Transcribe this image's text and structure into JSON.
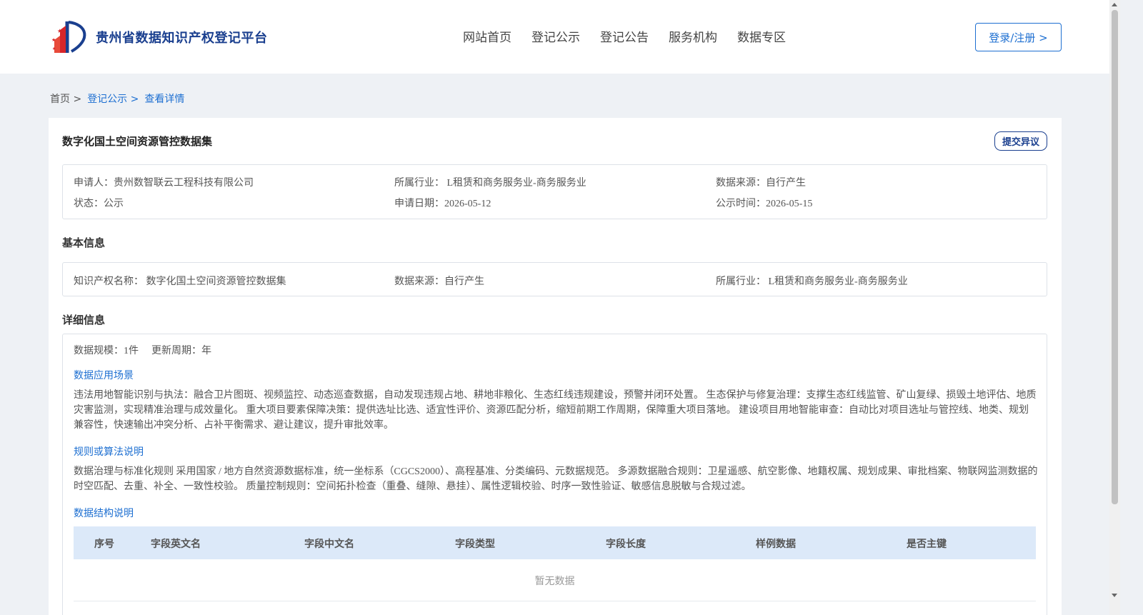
{
  "site": {
    "name": "贵州省数据知识产权登记平台"
  },
  "nav": {
    "items": [
      "网站首页",
      "登记公示",
      "登记公告",
      "服务机构",
      "数据专区"
    ]
  },
  "login": {
    "label": "登录/注册 >"
  },
  "breadcrumb": {
    "home": "首页 >",
    "level1": "登记公示 >",
    "level2": "查看详情"
  },
  "record": {
    "title": "数字化国土空间资源管控数据集",
    "objection_label": "提交异议",
    "summary": {
      "applicant": "申请人：贵州数智联云工程科技有限公司",
      "industry": "所属行业： L租赁和商务服务业-商务服务业",
      "source": "数据来源：自行产生",
      "status": "状态：公示",
      "apply_date": "申请日期：2026-05-12",
      "publish_date": "公示时间：2026-05-15"
    },
    "basic": {
      "heading": "基本信息",
      "ip_name": "知识产权名称： 数字化国土空间资源管控数据集",
      "source": "数据来源：自行产生",
      "industry": "所属行业： L租赁和商务服务业-商务服务业"
    },
    "detail": {
      "heading": "详细信息",
      "scale": "数据规模：1件",
      "cycle": "更新周期：年",
      "scenario_heading": "数据应用场景",
      "scenario_text": "违法用地智能识别与执法：融合卫片图斑、视频监控、动态巡查数据，自动发现违规占地、耕地非粮化、生态红线违规建设，预警并闭环处置。 生态保护与修复治理：支撑生态红线监管、矿山复绿、损毁土地评估、地质灾害监测，实现精准治理与成效量化。 重大项目要素保障决策：提供选址比选、适宜性评价、资源匹配分析，缩短前期工作周期，保障重大项目落地。 建设项目用地智能审查：自动比对项目选址与管控线、地类、规划兼容性，快速输出冲突分析、占补平衡需求、避让建议，提升审批效率。",
      "rules_heading": "规则或算法说明",
      "rules_text": "数据治理与标准化规则 采用国家 / 地方自然资源数据标准，统一坐标系（CGCS2000）、高程基准、分类编码、元数据规范。 多源数据融合规则：卫星遥感、航空影像、地籍权属、规划成果、审批档案、物联网监测数据的时空匹配、去重、补全、一致性校验。 质量控制规则：空间拓扑检查（重叠、缝隙、悬挂）、属性逻辑校验、时序一致性验证、敏感信息脱敏与合规过滤。",
      "structure_heading": "数据结构说明",
      "table_headers": [
        "序号",
        "字段英文名",
        "字段中文名",
        "字段类型",
        "字段长度",
        "样例数据",
        "是否主键"
      ],
      "empty_text": "暂无数据"
    }
  }
}
